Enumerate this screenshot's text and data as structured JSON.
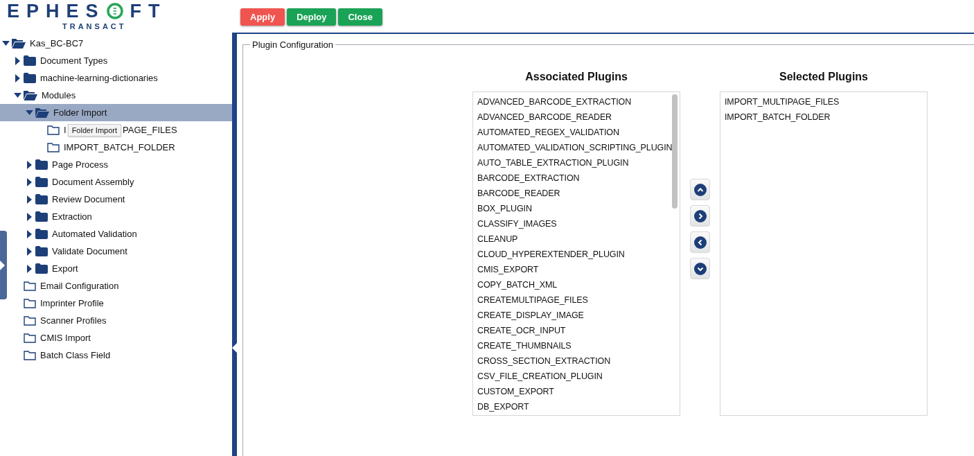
{
  "logo": {
    "text_before": "EPHES",
    "text_after": "FT",
    "subtitle": "TRANSACT"
  },
  "tree": [
    {
      "label": "Kas_BC-BC7",
      "kind": "branch",
      "expanded": true,
      "selected": false,
      "children": [
        {
          "label": "Document Types",
          "kind": "branch",
          "expanded": false,
          "selected": false
        },
        {
          "label": "machine-learning-dictionaries",
          "kind": "branch",
          "expanded": false,
          "selected": false
        },
        {
          "label": "Modules",
          "kind": "branch",
          "expanded": true,
          "selected": false,
          "children": [
            {
              "label": "Folder Import",
              "kind": "branch",
              "expanded": true,
              "selected": true,
              "children": [
                {
                  "label_parts": [
                    "I",
                    "PAGE_FILES"
                  ],
                  "tooltip": "Folder Import",
                  "kind": "leaf",
                  "selected": false
                },
                {
                  "label": "IMPORT_BATCH_FOLDER",
                  "kind": "leaf",
                  "selected": false
                }
              ]
            },
            {
              "label": "Page Process",
              "kind": "branch",
              "expanded": false,
              "selected": false
            },
            {
              "label": "Document Assembly",
              "kind": "branch",
              "expanded": false,
              "selected": false
            },
            {
              "label": "Review Document",
              "kind": "branch",
              "expanded": false,
              "selected": false
            },
            {
              "label": "Extraction",
              "kind": "branch",
              "expanded": false,
              "selected": false
            },
            {
              "label": "Automated Validation",
              "kind": "branch",
              "expanded": false,
              "selected": false
            },
            {
              "label": "Validate Document",
              "kind": "branch",
              "expanded": false,
              "selected": false
            },
            {
              "label": "Export",
              "kind": "branch",
              "expanded": false,
              "selected": false
            }
          ]
        },
        {
          "label": "Email Configuration",
          "kind": "leaf",
          "selected": false
        },
        {
          "label": "Imprinter Profile",
          "kind": "leaf",
          "selected": false
        },
        {
          "label": "Scanner Profiles",
          "kind": "leaf",
          "selected": false
        },
        {
          "label": "CMIS Import",
          "kind": "leaf",
          "selected": false
        },
        {
          "label": "Batch Class Field",
          "kind": "leaf",
          "selected": false
        }
      ]
    }
  ],
  "toolbar": [
    {
      "label": "Apply",
      "color": "#f0544f"
    },
    {
      "label": "Deploy",
      "color": "#1aa356"
    },
    {
      "label": "Close",
      "color": "#1aa356"
    }
  ],
  "panel": {
    "title": "Plugin Configuration",
    "associated": {
      "title": "Associated Plugins",
      "items": [
        "ADVANCED_BARCODE_EXTRACTION",
        "ADVANCED_BARCODE_READER",
        "AUTOMATED_REGEX_VALIDATION",
        "AUTOMATED_VALIDATION_SCRIPTING_PLUGIN",
        "AUTO_TABLE_EXTRACTION_PLUGIN",
        "BARCODE_EXTRACTION",
        "BARCODE_READER",
        "BOX_PLUGIN",
        "CLASSIFY_IMAGES",
        "CLEANUP",
        "CLOUD_HYPEREXTENDER_PLUGIN",
        "CMIS_EXPORT",
        "COPY_BATCH_XML",
        "CREATEMULTIPAGE_FILES",
        "CREATE_DISPLAY_IMAGE",
        "CREATE_OCR_INPUT",
        "CREATE_THUMBNAILS",
        "CROSS_SECTION_EXTRACTION",
        "CSV_FILE_CREATION_PLUGIN",
        "CUSTOM_EXPORT",
        "DB_EXPORT"
      ]
    },
    "move_buttons": [
      {
        "kind": "up"
      },
      {
        "kind": "right"
      },
      {
        "kind": "left"
      },
      {
        "kind": "down"
      }
    ],
    "selected": {
      "title": "Selected Plugins",
      "items": [
        "IMPORT_MULTIPAGE_FILES",
        "IMPORT_BATCH_FOLDER"
      ]
    }
  }
}
